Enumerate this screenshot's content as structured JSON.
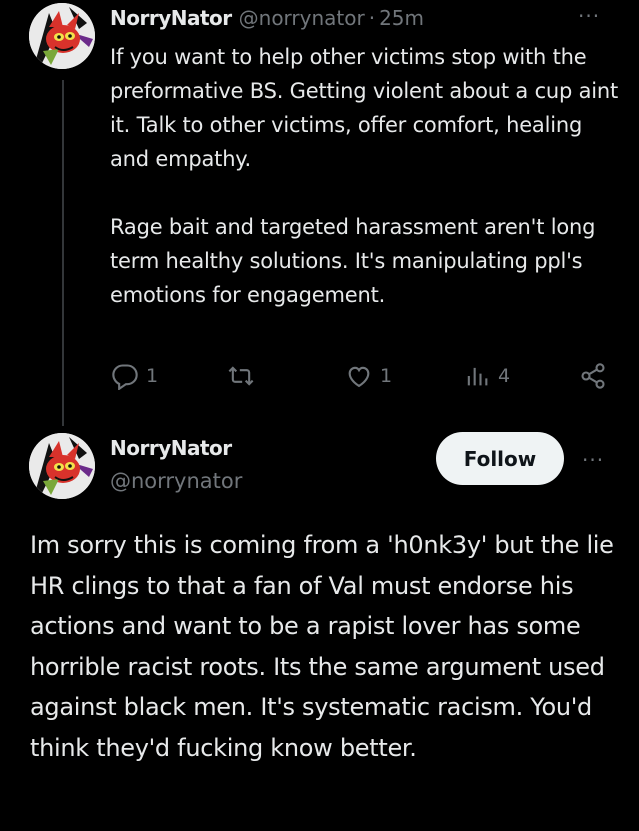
{
  "tweet1": {
    "display_name": "NorryNator",
    "handle": "@norrynator",
    "separator": "·",
    "time": "25m",
    "paragraphs": [
      "If you want to help other victims stop with the preformative BS. Getting violent about a cup aint it. Talk to other victims, offer comfort, healing and empathy.",
      "Rage bait and targeted harassment aren't long term healthy solutions. It's manipulating ppl's emotions for engagement."
    ],
    "reply_count": "1",
    "retweet_count": "",
    "like_count": "1",
    "view_count": "4",
    "more_label": "···"
  },
  "tweet2": {
    "display_name": "NorryNator",
    "handle": "@norrynator",
    "follow_label": "Follow",
    "more_label": "···",
    "body": "Im sorry this is coming from a 'h0nk3y' but the lie HR clings to that a fan of Val must endorse his actions and want to be a rapist lover has some horrible racist roots. Its the same argument used against black men. It's systematic racism. You'd think they'd fucking know better."
  },
  "icons": {
    "reply": "reply-icon",
    "retweet": "retweet-icon",
    "like": "heart-icon",
    "views": "views-icon",
    "share": "share-icon",
    "more": "more-icon"
  },
  "colors": {
    "background": "#000000",
    "text": "#e7e9ea",
    "muted": "#71767b",
    "follow_bg": "#eff3f4",
    "thread_line": "#333639"
  }
}
